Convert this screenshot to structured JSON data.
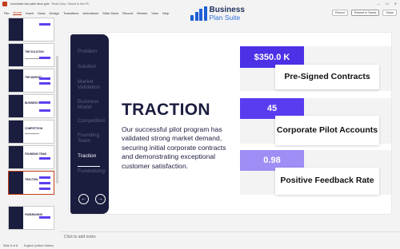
{
  "window": {
    "doc_title": "Innovative-tam pitch deck.pptx",
    "doc_status": "Read-Only • Saved to this PC",
    "controls": [
      "—",
      "☐",
      "✕"
    ]
  },
  "menu": {
    "items": [
      "File",
      "Home",
      "Insert",
      "Draw",
      "Design",
      "Transitions",
      "Animations",
      "Slide Show",
      "Record",
      "Review",
      "View",
      "Help"
    ],
    "active_index": 1,
    "record_label": "Record",
    "present_label": "Present in Teams",
    "share_label": "Share"
  },
  "brand": {
    "line1": "Business",
    "line2": "Plan Suite"
  },
  "thumbnails": [
    {
      "num": "",
      "title": ""
    },
    {
      "num": "",
      "title": "THE SOLUTION"
    },
    {
      "num": "",
      "title": "THE MARKET"
    },
    {
      "num": "",
      "title": "BUSINESS MODEL"
    },
    {
      "num": "",
      "title": "COMPETITION"
    },
    {
      "num": "",
      "title": "FOUNDING TEAM"
    },
    {
      "num": "",
      "title": "TRACTION"
    },
    {
      "num": "",
      "title": "FUNDRAISING"
    }
  ],
  "slide": {
    "nav": [
      "Problem",
      "Solution",
      "Market Validation",
      "Business Model",
      "Competition",
      "Founding Team",
      "Traction",
      "Fundraising"
    ],
    "active_nav_index": 6,
    "title": "TRACTION",
    "body": "Our successful pilot program has validated strong market demand, securing initial corporate contracts and demonstrating exceptional customer satisfaction.",
    "metrics": [
      {
        "value": "$350.0 K",
        "label": "Pre-Signed Contracts",
        "color": "#4b32e6"
      },
      {
        "value": "45",
        "label": "Corporate Pilot Accounts",
        "color": "#5a3cf0"
      },
      {
        "value": "0.98",
        "label": "Positive Feedback Rate",
        "color": "#9e8ef5"
      }
    ],
    "prev_icon": "←",
    "next_icon": "→"
  },
  "notes_placeholder": "Click to add notes",
  "status": {
    "slide_info": "Slide 8 of 8",
    "language": "English (United States)"
  }
}
